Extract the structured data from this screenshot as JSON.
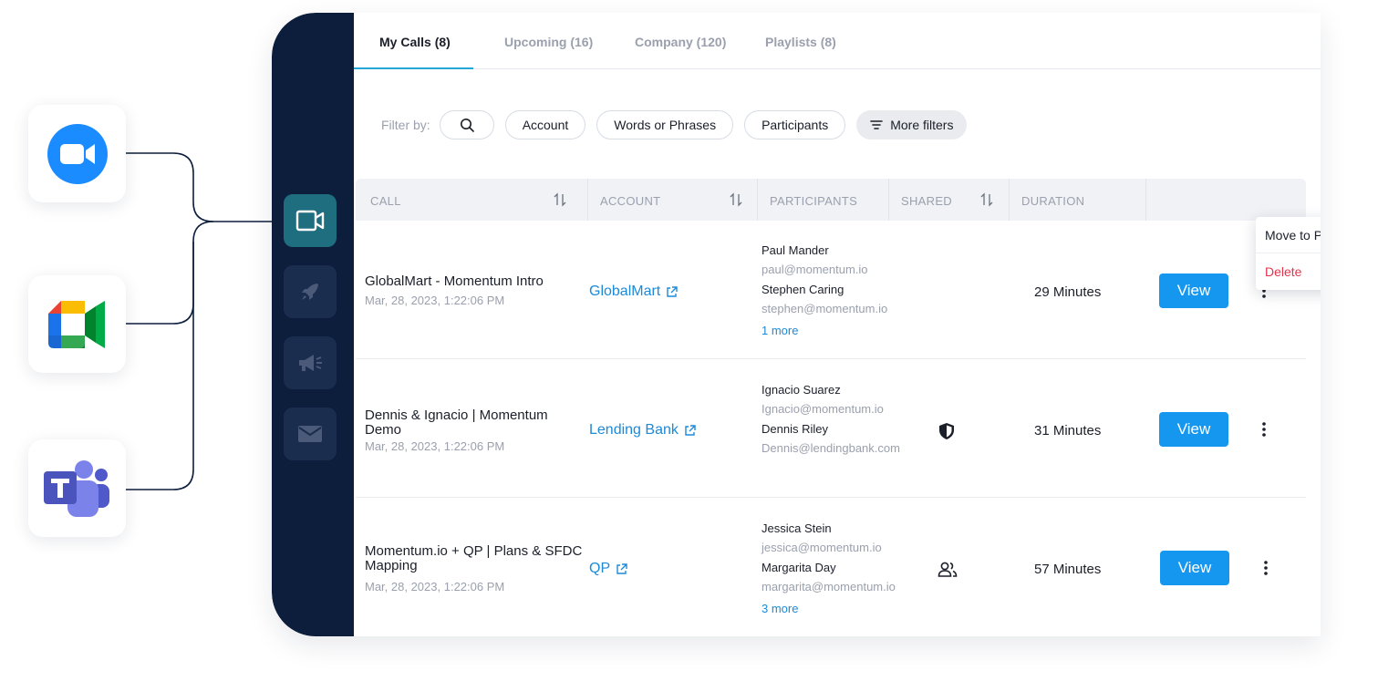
{
  "integrations": [
    {
      "name": "Zoom",
      "icon": "zoom-icon"
    },
    {
      "name": "Google Meet",
      "icon": "google-meet-icon"
    },
    {
      "name": "Microsoft Teams",
      "icon": "teams-icon"
    }
  ],
  "rail": {
    "items": [
      {
        "icon": "video-icon",
        "active": true
      },
      {
        "icon": "rocket-icon",
        "active": false
      },
      {
        "icon": "megaphone-icon",
        "active": false
      },
      {
        "icon": "mail-icon",
        "active": false
      }
    ]
  },
  "tabs": [
    {
      "label": "My Calls (8)",
      "active": true
    },
    {
      "label": "Upcoming (16)",
      "active": false
    },
    {
      "label": "Company (120)",
      "active": false
    },
    {
      "label": "Playlists (8)",
      "active": false
    }
  ],
  "filters": {
    "label": "Filter by:",
    "search_icon": "search-icon",
    "account": "Account",
    "words": "Words or Phrases",
    "participants": "Participants",
    "more": "More filters"
  },
  "table": {
    "headers": {
      "call": "CALL",
      "account": "ACCOUNT",
      "participants": "PARTICIPANTS",
      "shared": "SHARED",
      "duration": "DURATION"
    },
    "rows": [
      {
        "title": "GlobalMart - Momentum Intro",
        "date": "Mar, 28, 2023, 1:22:06 PM",
        "account": "GlobalMart",
        "p1_name": "Paul Mander",
        "p1_email": "paul@momentum.io",
        "p2_name": "Stephen Caring",
        "p2_email": "stephen@momentum.io",
        "more": "1 more",
        "shared_icon": "",
        "duration": "29 Minutes",
        "view": "View"
      },
      {
        "title": "Dennis & Ignacio | Momentum Demo",
        "date": "Mar, 28, 2023, 1:22:06 PM",
        "account": "Lending Bank",
        "p1_name": "Ignacio Suarez",
        "p1_email": "Ignacio@momentum.io",
        "p2_name": "Dennis Riley",
        "p2_email": "Dennis@lendingbank.com",
        "more": "",
        "shared_icon": "shield-icon",
        "duration": "31 Minutes",
        "view": "View"
      },
      {
        "title": "Momentum.io + QP | Plans & SFDC Mapping",
        "date": "Mar, 28, 2023, 1:22:06 PM",
        "account": "QP",
        "p1_name": "Jessica Stein",
        "p1_email": "jessica@momentum.io",
        "p2_name": "Margarita Day",
        "p2_email": "margarita@momentum.io",
        "more": "3 more",
        "shared_icon": "users-icon",
        "duration": "57 Minutes",
        "view": "View"
      }
    ]
  },
  "row_menu": {
    "move": "Move to Playlist",
    "delete": "Delete"
  },
  "colors": {
    "rail": "#0d1e3d",
    "rail_active": "#1f6e80",
    "primary": "#1597f0",
    "link": "#1c8ad8",
    "danger": "#e2344d",
    "tab_underline": "#23a7d8"
  }
}
